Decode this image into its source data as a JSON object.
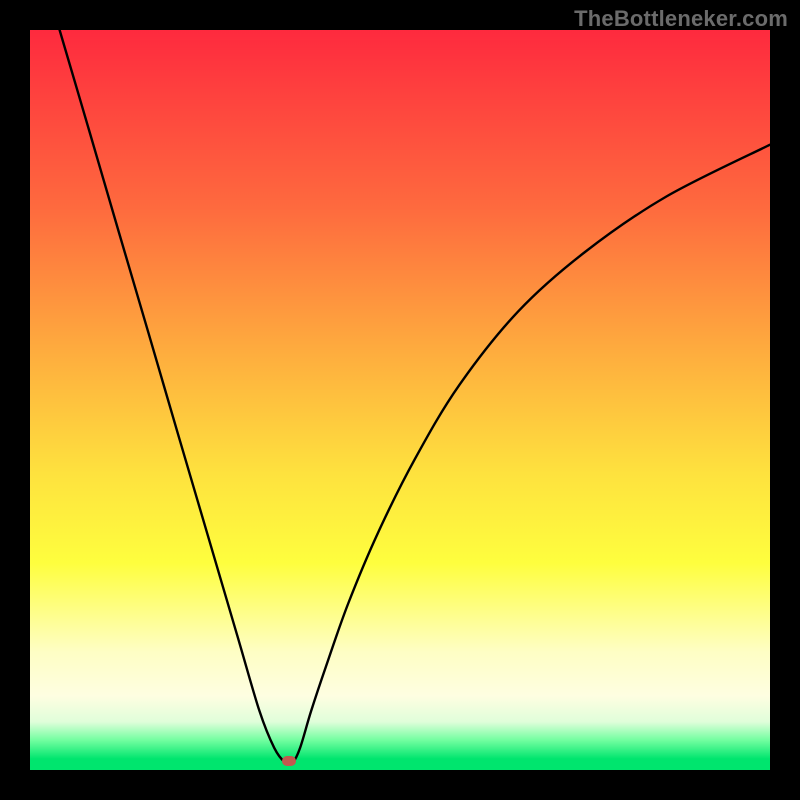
{
  "watermark": "TheBottleneker.com",
  "chart_data": {
    "type": "line",
    "title": "",
    "xlabel": "",
    "ylabel": "",
    "xlim": [
      0,
      100
    ],
    "ylim": [
      0,
      100
    ],
    "categories_note": "No axis tick labels are rendered in the source image; values are estimated on a 0–100 unit square inferred from the plot bounds.",
    "series": [
      {
        "name": "curve",
        "x": [
          4,
          8,
          12,
          16,
          20,
          24,
          28,
          31,
          33,
          34.5,
          35.5,
          36.5,
          38,
          40,
          43,
          47,
          52,
          58,
          66,
          75,
          86,
          100
        ],
        "y": [
          100,
          86.4,
          72.7,
          59.1,
          45.4,
          31.8,
          18.2,
          8.0,
          3.0,
          1.0,
          1.0,
          3.0,
          8.0,
          14.0,
          22.5,
          32.0,
          42.0,
          52.0,
          62.0,
          70.0,
          77.5,
          84.5
        ]
      }
    ],
    "marker": {
      "x": 35,
      "y": 1.2,
      "color": "#c1594f"
    },
    "background_gradient": {
      "top": "#fe2a3e",
      "mid": "#fee23e",
      "bottom": "#00e56e"
    }
  }
}
